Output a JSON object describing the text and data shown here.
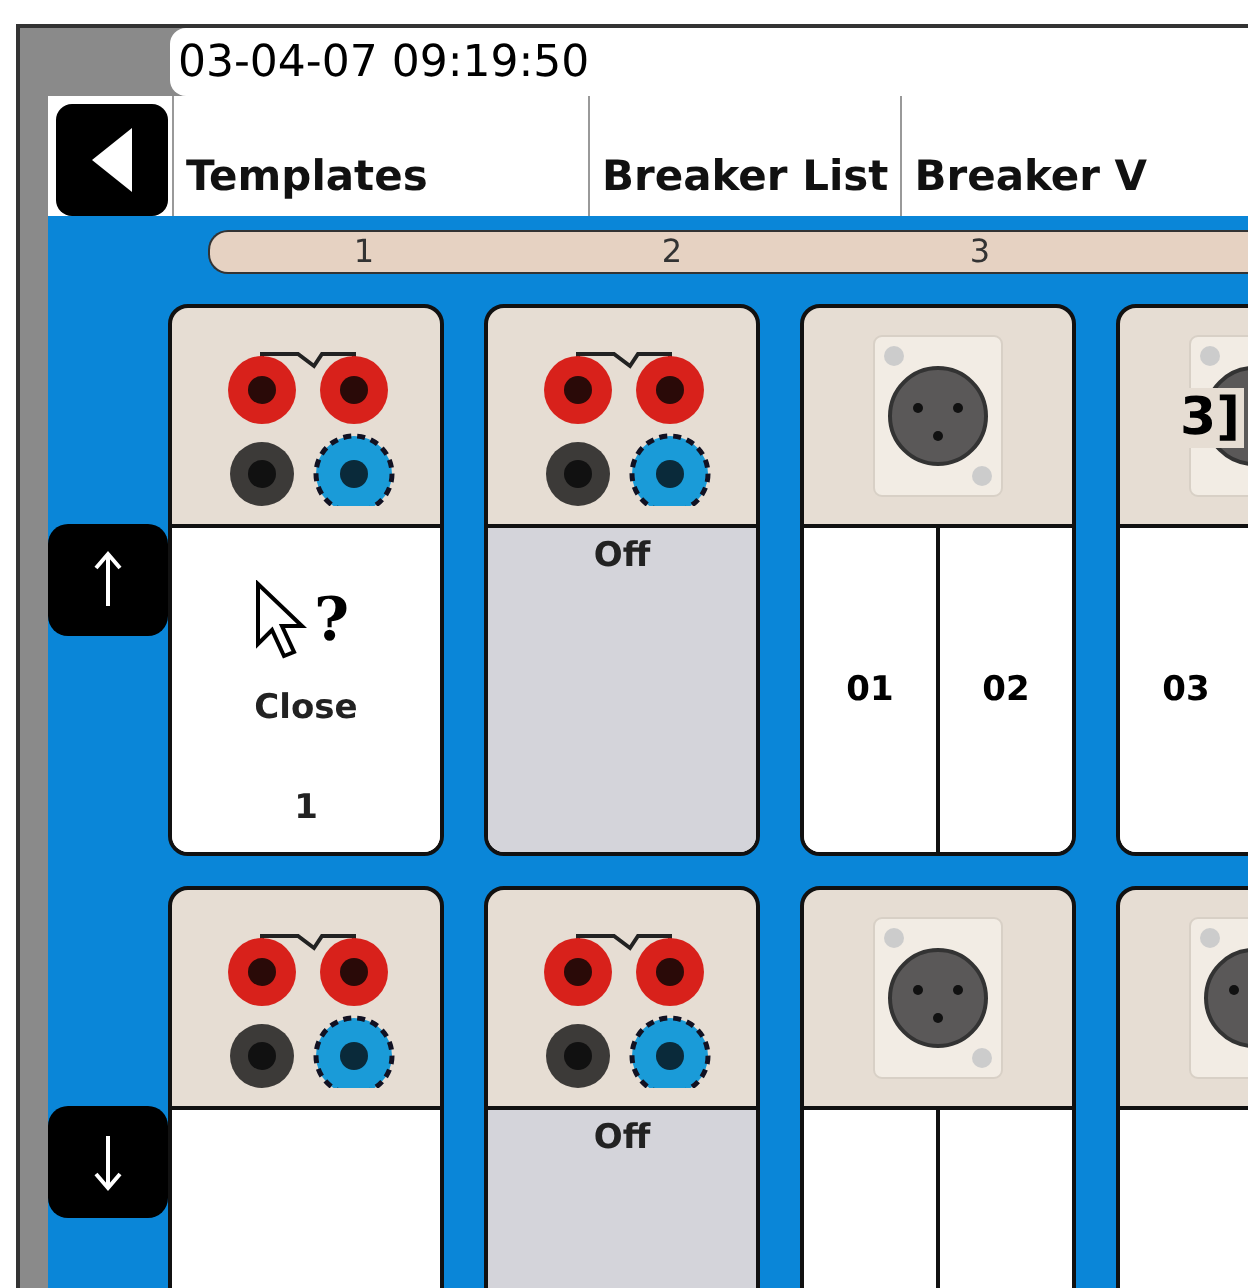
{
  "timestamp": "03-04-07 09:19:50",
  "tabs": [
    {
      "label": "Templates"
    },
    {
      "label": "Breaker List"
    },
    {
      "label": "Breaker V"
    }
  ],
  "scale": [
    "1",
    "2",
    "3"
  ],
  "rows": [
    {
      "cards": [
        {
          "kind": "jacks",
          "off": false,
          "status": "Close",
          "number": "1",
          "help_mark": "?"
        },
        {
          "kind": "jacks",
          "off": true,
          "status": "Off"
        },
        {
          "kind": "xlr",
          "channels": [
            "01",
            "02"
          ]
        },
        {
          "kind": "xlr",
          "channels": [
            "03"
          ],
          "overlay": "3]"
        }
      ]
    },
    {
      "cards": [
        {
          "kind": "jacks",
          "off": false
        },
        {
          "kind": "jacks",
          "off": true,
          "status": "Off"
        },
        {
          "kind": "xlr"
        },
        {
          "kind": "xlr"
        }
      ]
    }
  ]
}
